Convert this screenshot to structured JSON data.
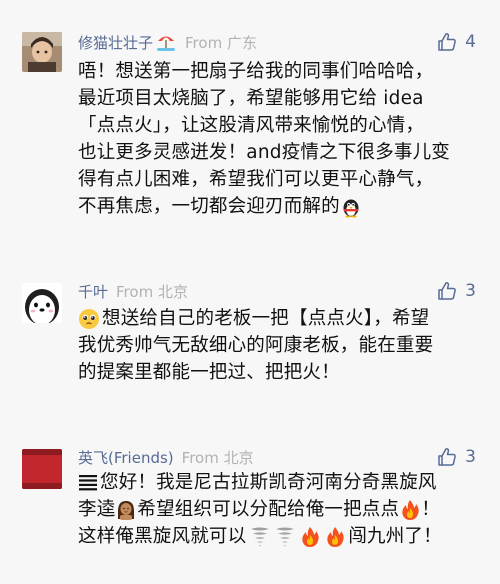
{
  "comments": [
    {
      "nickname": "修猫壮壮子",
      "nickname_emoji": "beach-umbrella-emoji",
      "location": "From 广东",
      "likes": "4",
      "text": {
        "l1": "唔！想送第一把扇子给我的同事们哈哈哈，",
        "l2": "最近项目太烧脑了，希望能够用它给 idea",
        "l3": "「点点火」，让这股清风带来愉悦的心情，",
        "l4": "也让更多灵感迸发！and疫情之下很多事儿变",
        "l5": "得有点儿困难，希望我们可以更平心静气，",
        "l6": "不再焦虑，一切都会迎刃而解的"
      },
      "trailing_emoji": "penguin-emoji"
    },
    {
      "nickname": "千叶",
      "location": "From 北京",
      "likes": "3",
      "leading_emoji": "pleading-face-emoji",
      "text": {
        "l1": "想送给自己的老板一把【点点火】，希望",
        "l2": "我优秀帅气无敌细心的阿康老板，能在重要",
        "l3": "的提案里都能一把过、把把火！"
      }
    },
    {
      "nickname": "英飞(Friends)",
      "location": "From 北京",
      "likes": "3",
      "text": {
        "l1_a": "您好！我是尼古拉斯凯奇河南分奇黑旋风",
        "l2_a": "李逵",
        "l2_b": "希望组织可以分配给俺一把点点",
        "l2_c": "！",
        "l3_a": "这样俺黑旋风就可以",
        "l3_b": "闯九州了！"
      }
    }
  ],
  "colors": {
    "background": "#f7f7f7",
    "nickname": "#576b95",
    "location": "#b2b2b2",
    "text": "#111111"
  }
}
